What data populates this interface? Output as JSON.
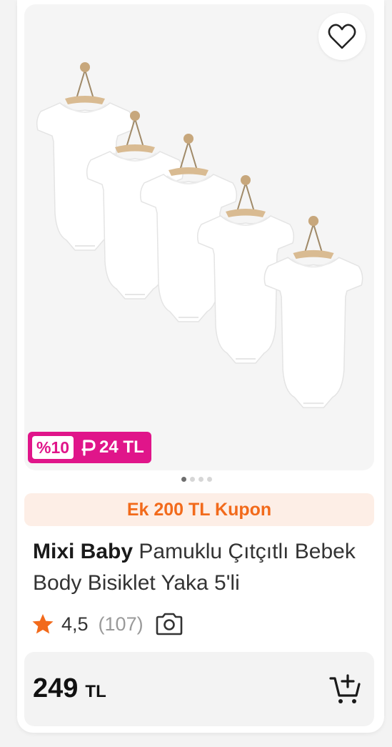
{
  "product": {
    "brand": "Mixi Baby",
    "name": " Pamuklu Çıtçıtlı Bebek Body Bisiklet Yaka 5'li",
    "image_alt": "white baby bodysuits on hangers",
    "favorite_icon": "heart-outline-icon"
  },
  "promo": {
    "percent": "%10",
    "amount": "24 TL",
    "icon": "p-coin-icon"
  },
  "carousel": {
    "total": 4,
    "active": 0
  },
  "coupon": {
    "label": "Ek 200 TL Kupon"
  },
  "rating": {
    "value": "4,5",
    "count": "(107)",
    "star_icon": "star-icon",
    "camera_icon": "camera-icon"
  },
  "price": {
    "amount": "249",
    "currency": "TL"
  },
  "cart": {
    "icon": "add-to-cart-icon"
  },
  "colors": {
    "promo": "#e0158a",
    "coupon_text": "#f26a1b",
    "coupon_bg": "#fdeee6",
    "star": "#f26a1b"
  }
}
